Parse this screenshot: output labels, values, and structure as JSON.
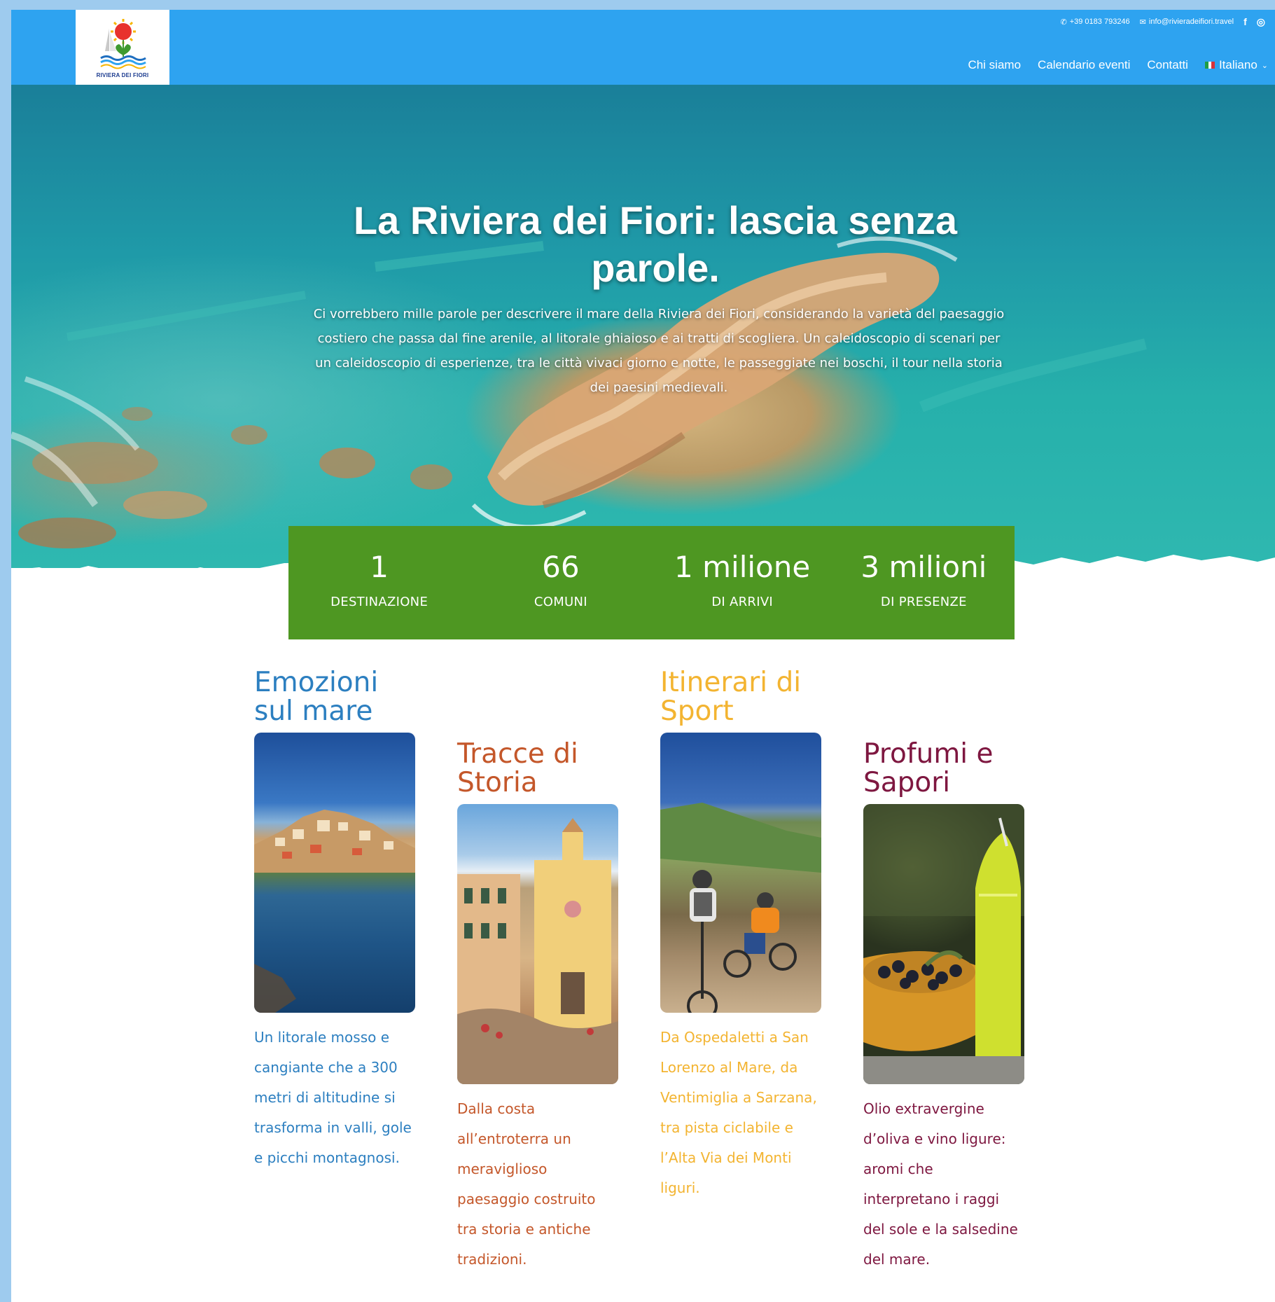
{
  "brand": {
    "logo_text": "RIVIERA DEI FIORI",
    "colors": {
      "header": "#2ea3f0",
      "stats": "#4e9722",
      "mare": "#2c7fc0",
      "storia": "#c4572a",
      "sport": "#f3b431",
      "sapori": "#7e1740"
    }
  },
  "topbar": {
    "phone": "+39 0183 793246",
    "email": "info@rivieradeifiori.travel",
    "facebook_label": "f",
    "instagram_label": "◎"
  },
  "nav": {
    "items": [
      "Chi siamo",
      "Calendario eventi",
      "Contatti"
    ],
    "language": "Italiano"
  },
  "hero": {
    "title": "La Riviera dei Fiori: lascia senza parole.",
    "text": "Ci vorrebbero mille parole per descrivere il mare della Riviera dei Fiori, considerando la varietà del paesaggio costiero che passa dal fine arenile, al litorale ghiaioso e ai tratti di scogliera. Un caleidoscopio di scenari per un caleidoscopio di esperienze, tra le città vivaci giorno e notte, le passeggiate nei boschi, il tour nella storia dei paesini medievali."
  },
  "stats": [
    {
      "number": "1",
      "label": "DESTINAZIONE"
    },
    {
      "number": "66",
      "label": "COMUNI"
    },
    {
      "number": "1 milione",
      "label": "DI ARRIVI"
    },
    {
      "number": "3 milioni",
      "label": "DI PRESENZE"
    }
  ],
  "cards": [
    {
      "title": "Emozioni\nsul mare",
      "text": "Un litorale mosso e cangiante che a 300 metri di altitudine si trasforma in valli, gole e picchi montagnosi.",
      "color": "#2c7fc0",
      "image": "coastal-village-photo"
    },
    {
      "title": "Tracce di\nStoria",
      "text": "Dalla costa all’entroterra un meraviglioso paesaggio costruito tra storia e antiche tradizioni.",
      "color": "#c4572a",
      "image": "historic-church-photo"
    },
    {
      "title": "Itinerari di\nSport",
      "text": "Da Ospedaletti a San Lorenzo al Mare, da Ventimiglia a Sarzana, tra pista ciclabile e l’Alta Via dei Monti liguri.",
      "color": "#f3b431",
      "image": "mountain-bikers-photo"
    },
    {
      "title": "Profumi e\nSapori",
      "text": "Olio extravergine d’oliva e vino ligure: aromi che interpretano i raggi del sole e la salsedine del mare.",
      "color": "#7e1740",
      "image": "olives-and-oil-photo"
    }
  ]
}
